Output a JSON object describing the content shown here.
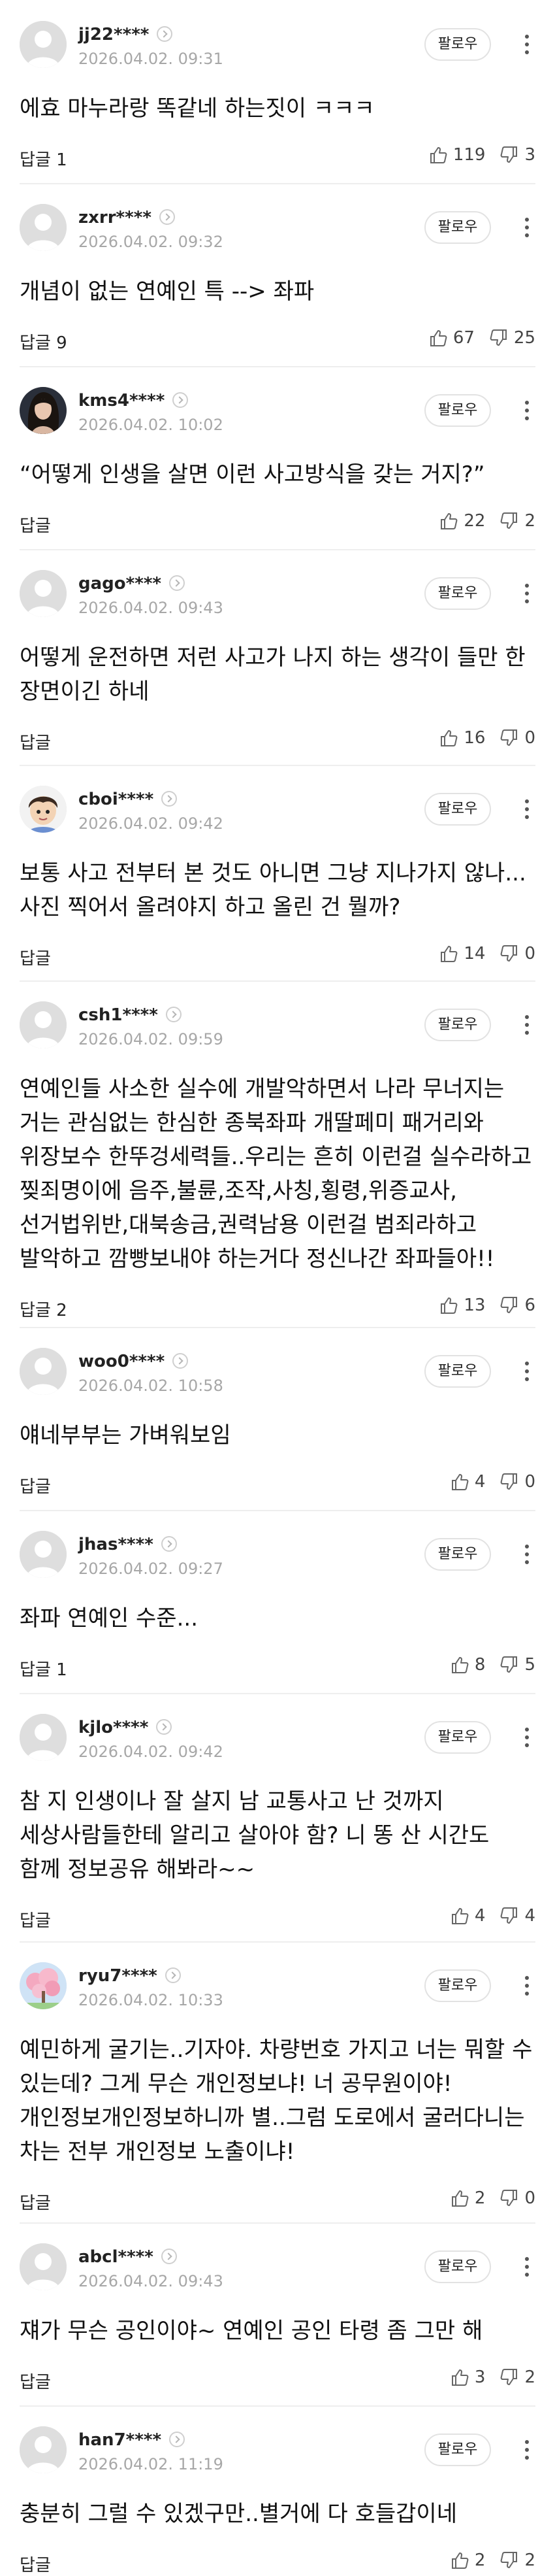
{
  "follow_label": "팔로우",
  "comments": [
    {
      "username": "jj22****",
      "date": "2026.04.02. 09:31",
      "text": "에효 마누라랑 똑같네 하는짓이 ㅋㅋㅋ",
      "reply": "답글 1",
      "likes": "119",
      "dislikes": "3",
      "avatar": "default"
    },
    {
      "username": "zxrr****",
      "date": "2026.04.02. 09:32",
      "text": "개념이 없는 연예인 특 --> 좌파",
      "reply": "답글 9",
      "likes": "67",
      "dislikes": "25",
      "avatar": "default"
    },
    {
      "username": "kms4****",
      "date": "2026.04.02. 10:02",
      "text": "“어떻게 인생을 살면 이런 사고방식을 갖는 거지?”",
      "reply": "답글",
      "likes": "22",
      "dislikes": "2",
      "avatar": "photo-woman"
    },
    {
      "username": "gago****",
      "date": "2026.04.02. 09:43",
      "text": "어떻게 운전하면 저런 사고가 나지 하는 생각이 들만 한 장면이긴 하네",
      "reply": "답글",
      "likes": "16",
      "dislikes": "0",
      "avatar": "default"
    },
    {
      "username": "cboi****",
      "date": "2026.04.02. 09:42",
      "text": "보통 사고 전부터 본 것도 아니면 그냥 지나가지 않나... 사진 찍어서 올려야지 하고 올린 건 뭘까?",
      "reply": "답글",
      "likes": "14",
      "dislikes": "0",
      "avatar": "cartoon-boy"
    },
    {
      "username": "csh1****",
      "date": "2026.04.02. 09:59",
      "text": "연예인들 사소한 실수에 개발악하면서 나라 무너지는 거는 관심없는 한심한 종북좌파 개딸페미 패거리와 위장보수 한뚜겅세력들..우리는 흔히 이런걸 실수라하고 찢죄명이에 음주,불륜,조작,사칭,횡령,위증교사,선거법위반,대북송금,권력남용 이런걸 범죄라하고 발악하고 깜빵보내야 하는거다 정신나간 좌파들아!!",
      "reply": "답글 2",
      "likes": "13",
      "dislikes": "6",
      "avatar": "default"
    },
    {
      "username": "woo0****",
      "date": "2026.04.02. 10:58",
      "text": "얘네부부는 가벼워보임",
      "reply": "답글",
      "likes": "4",
      "dislikes": "0",
      "avatar": "default"
    },
    {
      "username": "jhas****",
      "date": "2026.04.02. 09:27",
      "text": "좌파 연예인 수준...",
      "reply": "답글 1",
      "likes": "8",
      "dislikes": "5",
      "avatar": "default"
    },
    {
      "username": "kjlo****",
      "date": "2026.04.02. 09:42",
      "text": "참 지 인생이나 잘 살지 남 교통사고 난 것까지 세상사람들한테 알리고 살아야 함? 니 똥 산 시간도 함께 정보공유 해봐라~~",
      "reply": "답글",
      "likes": "4",
      "dislikes": "4",
      "avatar": "default"
    },
    {
      "username": "ryu7****",
      "date": "2026.04.02. 10:33",
      "text": "예민하게 굴기는..기자야. 차량번호 가지고 너는 뭐할 수 있는데? 그게 무슨 개인정보냐! 너 공무원이야! 개인정보개인정보하니까 별..그럼 도로에서 굴러다니는 차는 전부 개인정보 노출이냐!",
      "reply": "답글",
      "likes": "2",
      "dislikes": "0",
      "avatar": "photo-tree"
    },
    {
      "username": "abcl****",
      "date": "2026.04.02. 09:43",
      "text": "쟤가 무슨 공인이야~ 연예인 공인 타령 좀 그만 해",
      "reply": "답글",
      "likes": "3",
      "dislikes": "2",
      "avatar": "default"
    },
    {
      "username": "han7****",
      "date": "2026.04.02. 11:19",
      "text": "충분히 그럴 수 있겠구만..별거에 다 호들갑이네",
      "reply": "답글",
      "likes": "2",
      "dislikes": "2",
      "avatar": "default"
    }
  ]
}
